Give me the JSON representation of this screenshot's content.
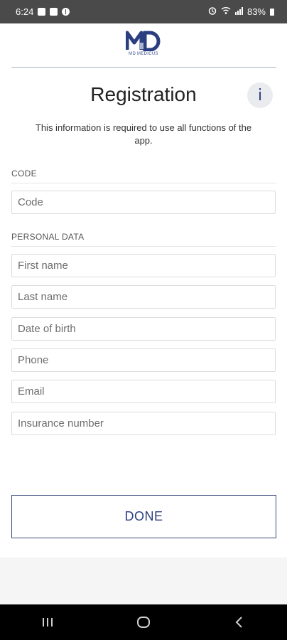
{
  "status_bar": {
    "time": "6:24",
    "battery": "83%"
  },
  "header": {
    "logo_text": "MD MEDICUS"
  },
  "page": {
    "title": "Registration",
    "info_label": "i",
    "subtitle": "This information is required to use all functions of the app."
  },
  "sections": {
    "code": {
      "label": "CODE",
      "fields": {
        "code": {
          "placeholder": "Code",
          "value": ""
        }
      }
    },
    "personal": {
      "label": "PERSONAL DATA",
      "fields": {
        "first_name": {
          "placeholder": "First name",
          "value": ""
        },
        "last_name": {
          "placeholder": "Last name",
          "value": ""
        },
        "date_of_birth": {
          "placeholder": "Date of birth",
          "value": ""
        },
        "phone": {
          "placeholder": "Phone",
          "value": ""
        },
        "email": {
          "placeholder": "Email",
          "value": ""
        },
        "insurance_number": {
          "placeholder": "Insurance number",
          "value": ""
        }
      }
    }
  },
  "actions": {
    "done_label": "DONE"
  },
  "colors": {
    "brand": "#2b3f80",
    "status_bar": "#4a4a4a",
    "nav_bar": "#000000"
  },
  "nav": {
    "icons": [
      "recents-icon",
      "home-icon",
      "back-icon"
    ]
  }
}
